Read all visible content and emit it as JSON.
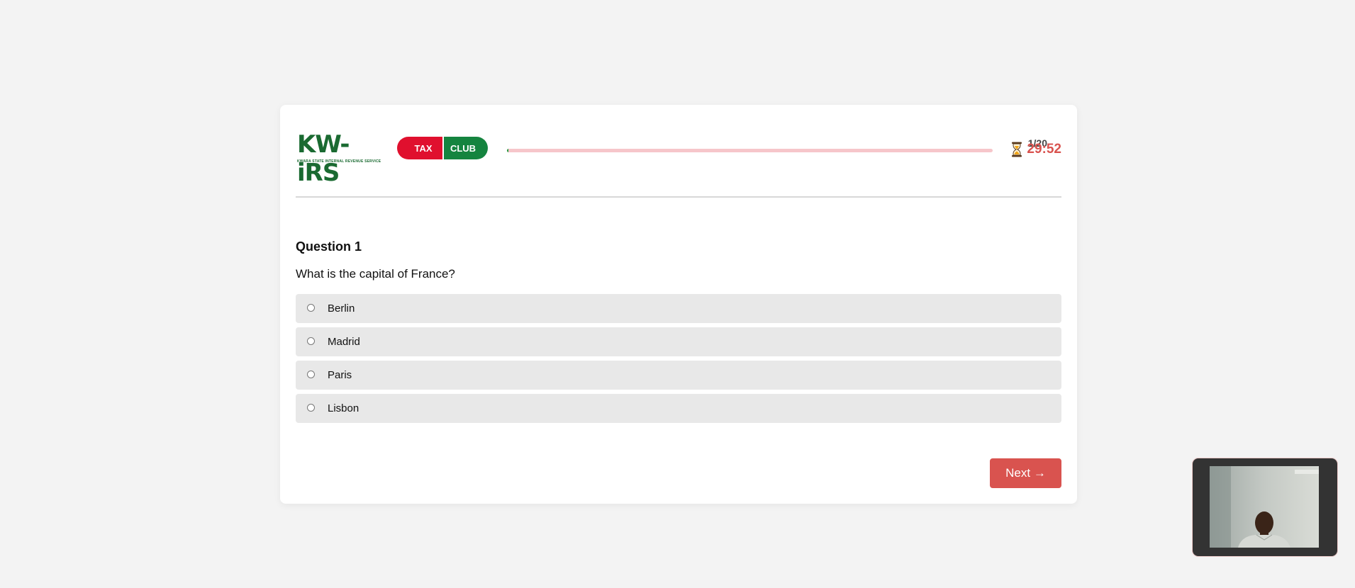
{
  "header": {
    "logo_kwirs": {
      "text": "KW-iRS",
      "subtitle": "KWARA STATE INTERNAL REVENUE SERVICE"
    },
    "logo_taxclub": {
      "left": "TAX",
      "right": "CLUB"
    },
    "progress": {
      "count_label": "1/20",
      "fraction": 0.003
    },
    "timer": {
      "icon": "hourglass-icon",
      "value": "29:52"
    }
  },
  "question": {
    "title": "Question 1",
    "text": "What is the capital of France?",
    "options": [
      {
        "label": "Berlin"
      },
      {
        "label": "Madrid"
      },
      {
        "label": "Paris"
      },
      {
        "label": "Lisbon"
      }
    ]
  },
  "footer": {
    "next_label": "Next →"
  },
  "colors": {
    "accent": "#d9534f",
    "brand_green": "#1a6a31",
    "progress_track": "#f6c6ca",
    "progress_fill": "#1f9a3e",
    "option_bg": "#e8e8e8",
    "page_bg": "#f3f3f3"
  }
}
